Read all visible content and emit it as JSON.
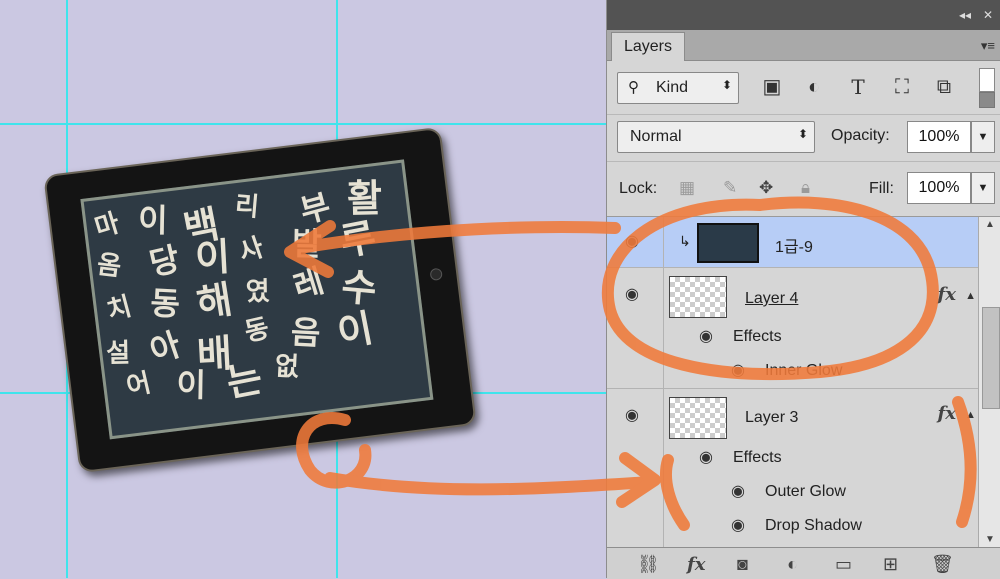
{
  "panel": {
    "tab_label": "Layers",
    "collapse_glyph": "◂◂",
    "close_glyph": "✕",
    "menu_glyph": "▾≡",
    "filter": {
      "label": "Kind",
      "icon": "search-icon"
    },
    "filter_icons": [
      "image-icon",
      "adjustment-icon",
      "type-icon",
      "shape-icon",
      "smart-object-icon"
    ],
    "blend_mode": "Normal",
    "opacity_label": "Opacity:",
    "opacity_value": "100%",
    "lock_label": "Lock:",
    "fill_label": "Fill:",
    "fill_value": "100%"
  },
  "layers": [
    {
      "name": "1급-9",
      "selected": true,
      "clipped": true
    },
    {
      "name": "Layer 4",
      "fx": "fx",
      "effects_label": "Effects",
      "effects": [
        "Inner Glow"
      ]
    },
    {
      "name": "Layer 3",
      "fx": "fx",
      "effects_label": "Effects",
      "effects": [
        "Outer Glow",
        "Drop Shadow"
      ]
    }
  ],
  "bottom_icons": [
    "link-icon",
    "fx-icon",
    "mask-icon",
    "adjustment-layer-icon",
    "group-folder-icon",
    "new-layer-icon",
    "trash-icon"
  ],
  "canvas": {
    "glyphs": [
      "마",
      "이",
      "백",
      "리",
      "부",
      "활",
      "옴",
      "당",
      "이",
      "사",
      "발",
      "루",
      "치",
      "동",
      "해",
      "였",
      "레",
      "수",
      "설",
      "아",
      "배",
      "동",
      "음",
      "이",
      "어",
      "이",
      "는",
      "없"
    ]
  },
  "colors": {
    "canvas_bg": "#cbc8e2",
    "guide": "#3fe4ec",
    "annotation": "#f07a3a",
    "selected_row": "#b7cdf6"
  }
}
